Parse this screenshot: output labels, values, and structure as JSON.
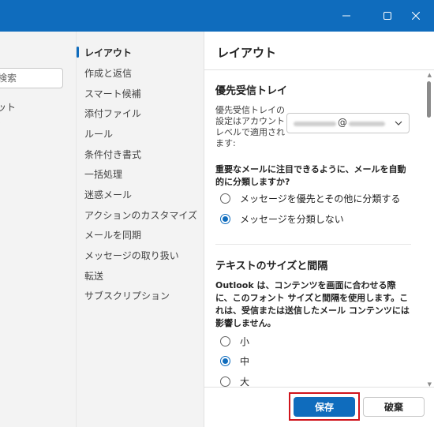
{
  "left_pane": {
    "search_placeholder": "検索",
    "items": [
      "ット",
      "/"
    ]
  },
  "nav": {
    "items": [
      {
        "label": "レイアウト",
        "active": true
      },
      {
        "label": "作成と返信"
      },
      {
        "label": "スマート候補"
      },
      {
        "label": "添付ファイル"
      },
      {
        "label": "ルール"
      },
      {
        "label": "条件付き書式"
      },
      {
        "label": "一括処理"
      },
      {
        "label": "迷惑メール"
      },
      {
        "label": "アクションのカスタマイズ"
      },
      {
        "label": "メールを同期"
      },
      {
        "label": "メッセージの取り扱い"
      },
      {
        "label": "転送"
      },
      {
        "label": "サブスクリプション"
      }
    ]
  },
  "content": {
    "header": "レイアウト",
    "focused_inbox": {
      "title": "優先受信トレイ",
      "account_label": "優先受信トレイの設定はアカウントレベルで適用されます:",
      "account_at": "@",
      "question": "重要なメールに注目できるように、メールを自動的に分類しますか?",
      "options": [
        {
          "label": "メッセージを優先とその他に分類する",
          "checked": false
        },
        {
          "label": "メッセージを分類しない",
          "checked": true
        }
      ]
    },
    "text_size": {
      "title": "テキストのサイズと間隔",
      "question": "Outlook は、コンテンツを画面に合わせる際に、このフォント サイズと間隔を使用します。これは、受信または送信したメール コンテンツには影響しません。",
      "options": [
        {
          "label": "小",
          "checked": false
        },
        {
          "label": "中",
          "checked": true
        },
        {
          "label": "大",
          "checked": false
        }
      ]
    }
  },
  "footer": {
    "save_label": "保存",
    "discard_label": "破棄"
  },
  "colors": {
    "accent": "#0f6cbd",
    "highlight": "#d0141c"
  }
}
